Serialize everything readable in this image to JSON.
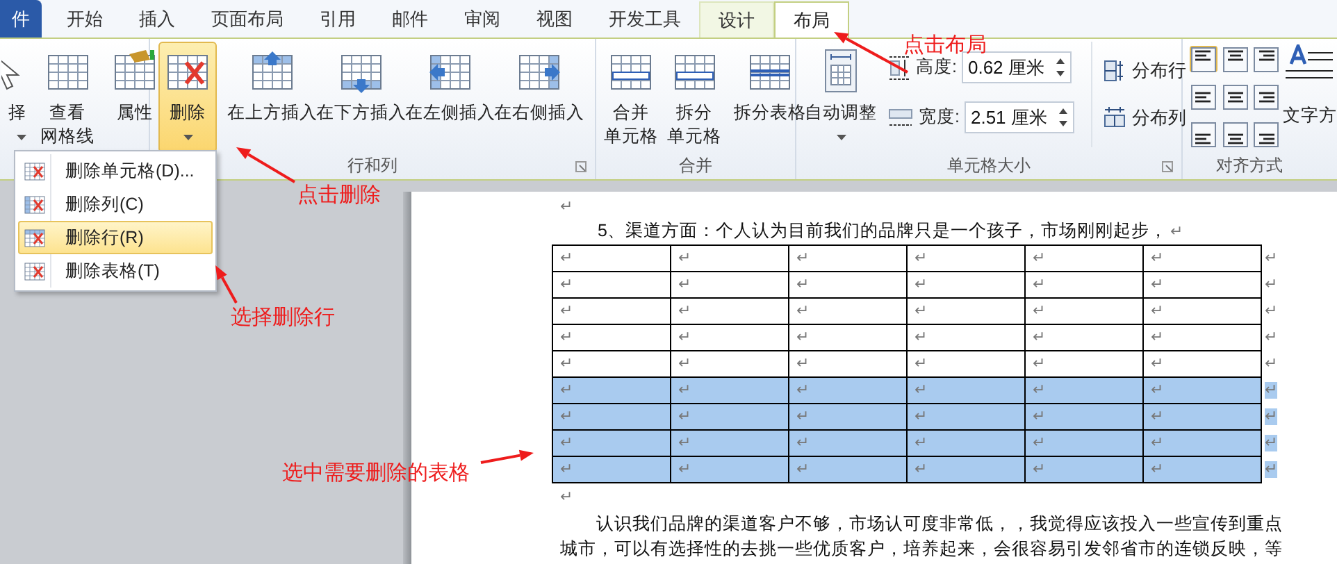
{
  "tabs": [
    {
      "label": "件",
      "kind": "file",
      "selected": false
    },
    {
      "label": "开始",
      "kind": "normal",
      "selected": false
    },
    {
      "label": "插入",
      "kind": "normal",
      "selected": false
    },
    {
      "label": "页面布局",
      "kind": "normal",
      "selected": false
    },
    {
      "label": "引用",
      "kind": "normal",
      "selected": false
    },
    {
      "label": "邮件",
      "kind": "normal",
      "selected": false
    },
    {
      "label": "审阅",
      "kind": "normal",
      "selected": false
    },
    {
      "label": "视图",
      "kind": "normal",
      "selected": false
    },
    {
      "label": "开发工具",
      "kind": "normal",
      "selected": false
    },
    {
      "label": "设计",
      "kind": "contextual",
      "selected": false
    },
    {
      "label": "布局",
      "kind": "contextual",
      "selected": true
    }
  ],
  "ribbon": {
    "table_group": {
      "buttons": [
        {
          "lines": [
            "择"
          ],
          "dropdown": true
        },
        {
          "lines": [
            "查看",
            "网格线"
          ],
          "dropdown": false
        },
        {
          "lines": [
            "属性"
          ],
          "dropdown": false
        }
      ]
    },
    "rows_columns": {
      "label": "行和列",
      "buttons": [
        {
          "lines": [
            "删除"
          ],
          "dropdown": true,
          "selected": true
        },
        {
          "lines": [
            "在上方插入"
          ],
          "dropdown": false,
          "selected": false
        },
        {
          "lines": [
            "在下方插入"
          ],
          "dropdown": false,
          "selected": false
        },
        {
          "lines": [
            "在左侧插入"
          ],
          "dropdown": false,
          "selected": false
        },
        {
          "lines": [
            "在右侧插入"
          ],
          "dropdown": false,
          "selected": false
        }
      ]
    },
    "merge": {
      "label": "合并",
      "buttons": [
        {
          "lines": [
            "合并",
            "单元格"
          ],
          "dropdown": false
        },
        {
          "lines": [
            "拆分",
            "单元格"
          ],
          "dropdown": false
        },
        {
          "lines": [
            "拆分表格"
          ],
          "dropdown": false
        }
      ]
    },
    "cell_size": {
      "label": "单元格大小",
      "autofit": {
        "lines": [
          "自动调整"
        ],
        "dropdown": true
      },
      "fields": [
        {
          "kind": "height",
          "label": "高度:",
          "value": "0.62 厘米"
        },
        {
          "kind": "width",
          "label": "宽度:",
          "value": "2.51 厘米"
        }
      ],
      "distribute": [
        {
          "kind": "rows",
          "label": "分布行"
        },
        {
          "kind": "columns",
          "label": "分布列"
        }
      ]
    },
    "alignment": {
      "label": "对齐方式",
      "options": [
        {
          "selected": true
        },
        {
          "selected": false
        },
        {
          "selected": false
        },
        {
          "selected": false
        },
        {
          "selected": false
        },
        {
          "selected": false
        },
        {
          "selected": false
        },
        {
          "selected": false
        },
        {
          "selected": false
        }
      ],
      "text_direction": {
        "label": "文字方"
      }
    }
  },
  "delete_menu": {
    "items": [
      {
        "label": "删除单元格(D)...",
        "selected": false
      },
      {
        "label": "删除列(C)",
        "selected": false
      },
      {
        "label": "删除行(R)",
        "selected": true
      },
      {
        "label": "删除表格(T)",
        "selected": false
      }
    ]
  },
  "document": {
    "top_mark": "↵",
    "heading": "5、渠道方面：个人认为目前我们的品牌只是一个孩子，市场刚刚起步，",
    "heading_mark": "↵",
    "table": {
      "rows": [
        {
          "selected": false,
          "cells": [
            "↵",
            "↵",
            "↵",
            "↵",
            "↵",
            "↵"
          ],
          "end_mark": "↵"
        },
        {
          "selected": false,
          "cells": [
            "↵",
            "↵",
            "↵",
            "↵",
            "↵",
            "↵"
          ],
          "end_mark": "↵"
        },
        {
          "selected": false,
          "cells": [
            "↵",
            "↵",
            "↵",
            "↵",
            "↵",
            "↵"
          ],
          "end_mark": "↵"
        },
        {
          "selected": false,
          "cells": [
            "↵",
            "↵",
            "↵",
            "↵",
            "↵",
            "↵"
          ],
          "end_mark": "↵"
        },
        {
          "selected": false,
          "cells": [
            "↵",
            "↵",
            "↵",
            "↵",
            "↵",
            "↵"
          ],
          "end_mark": "↵"
        },
        {
          "selected": true,
          "cells": [
            "↵",
            "↵",
            "↵",
            "↵",
            "↵",
            "↵"
          ],
          "end_mark": "↵"
        },
        {
          "selected": true,
          "cells": [
            "↵",
            "↵",
            "↵",
            "↵",
            "↵",
            "↵"
          ],
          "end_mark": "↵"
        },
        {
          "selected": true,
          "cells": [
            "↵",
            "↵",
            "↵",
            "↵",
            "↵",
            "↵"
          ],
          "end_mark": "↵"
        },
        {
          "selected": true,
          "cells": [
            "↵",
            "↵",
            "↵",
            "↵",
            "↵",
            "↵"
          ],
          "end_mark": "↵"
        }
      ]
    },
    "after_table_mark": "↵",
    "paragraph": "认识我们品牌的渠道客户不够，市场认可度非常低，，我觉得应该投入一些宣传到重点城市，可以有选择性的去挑一些优质客户，培养起来，会很容易引发邻省市的连锁反映，等"
  },
  "annotations": [
    {
      "text": "点击布局"
    },
    {
      "text": "点击删除"
    },
    {
      "text": "选择删除行"
    },
    {
      "text": "选中需要删除的表格"
    }
  ]
}
